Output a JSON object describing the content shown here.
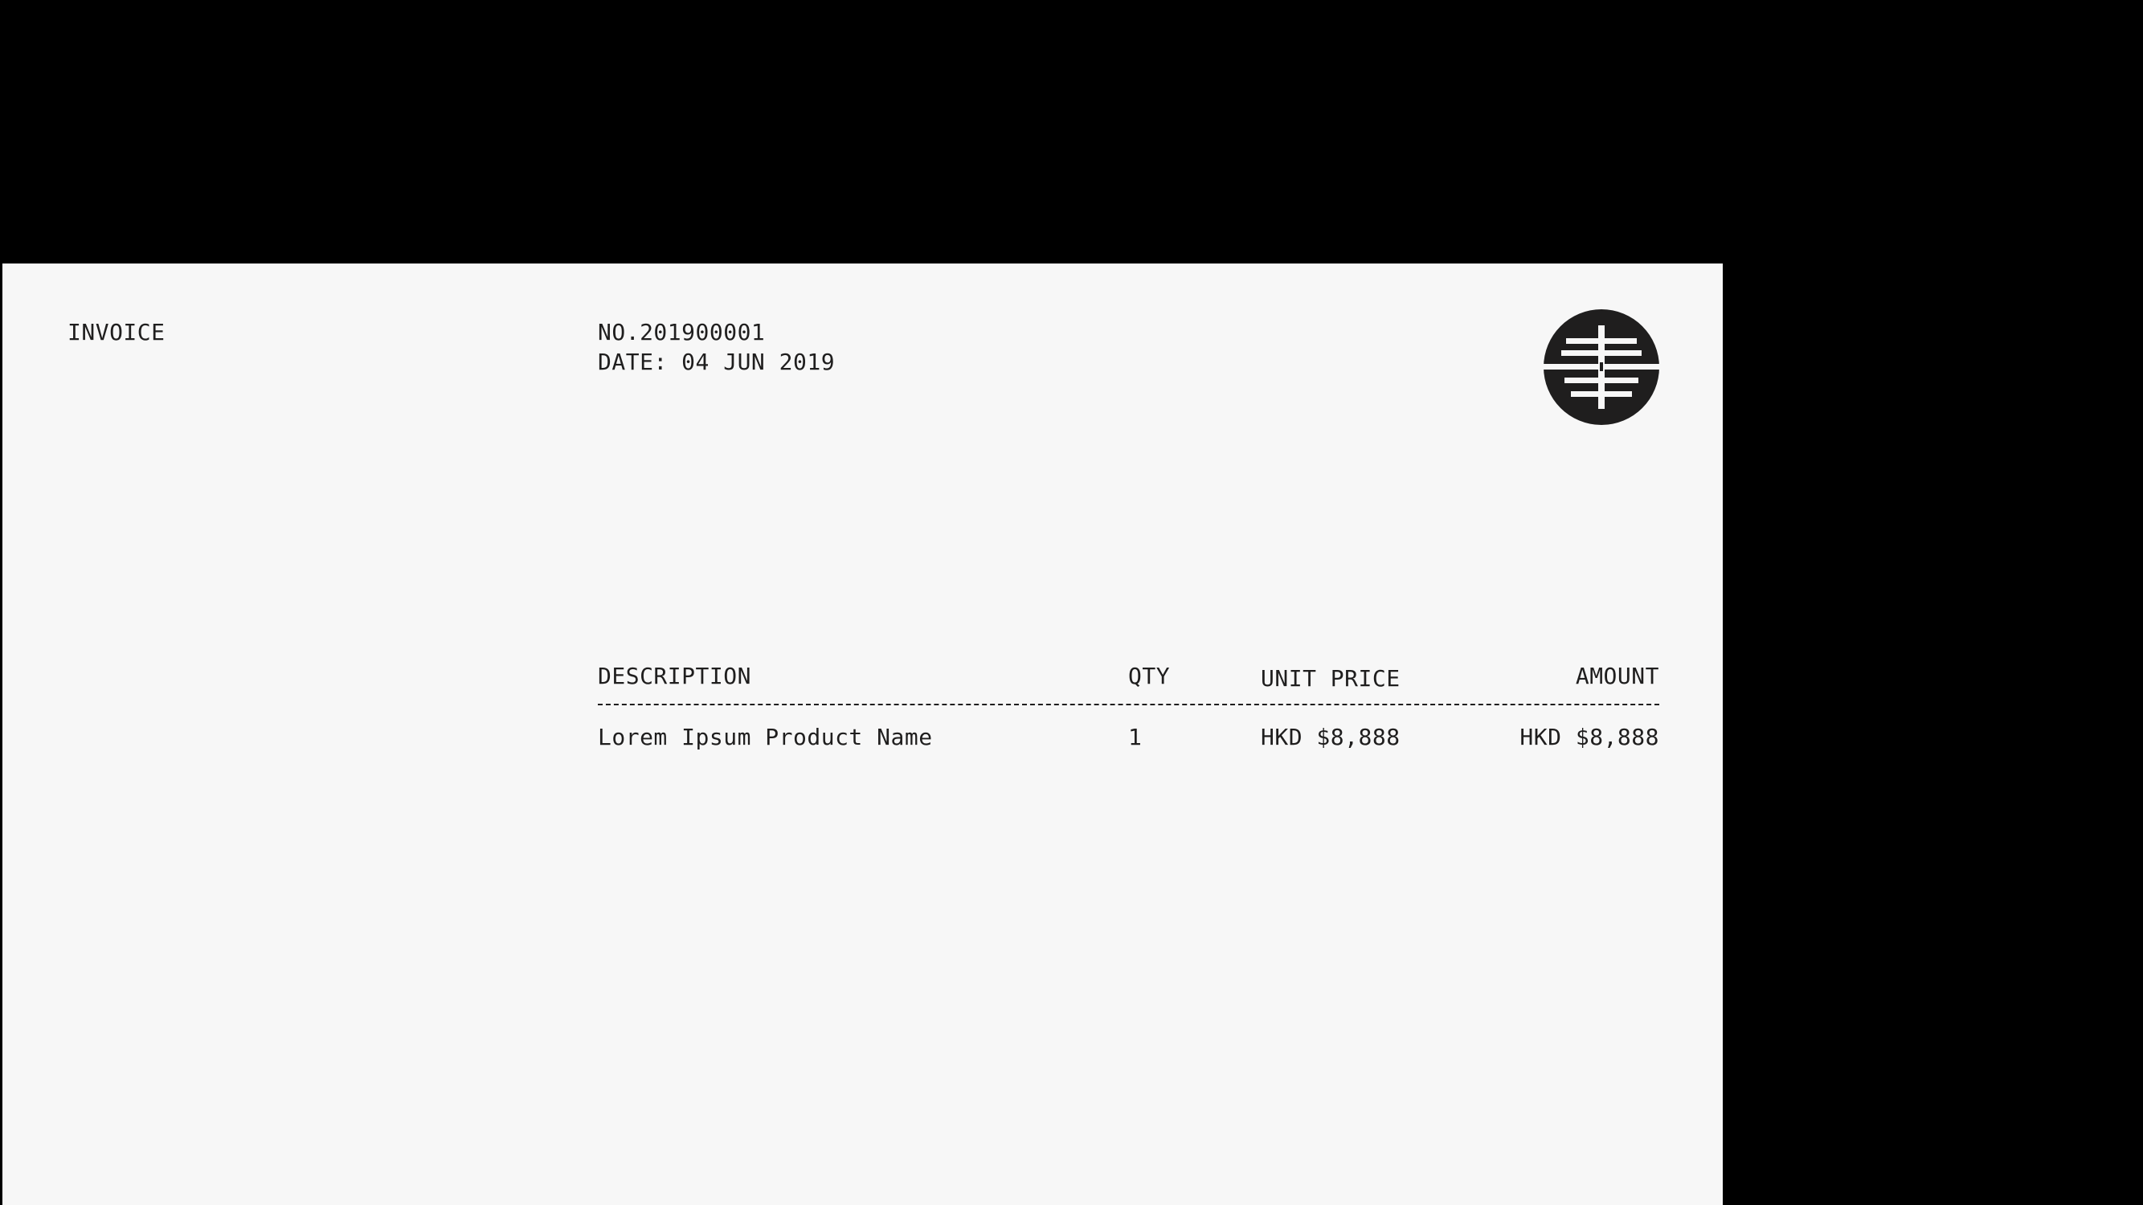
{
  "document": {
    "title": "INVOICE",
    "number": "NO.201900001",
    "date": "DATE: 04 JUN 2019"
  },
  "logo": {
    "icon": "circular-emblem-logo",
    "color": "#1f1e1e"
  },
  "table": {
    "headers": {
      "description": "DESCRIPTION",
      "qty": "QTY",
      "unit_price": "UNIT PRICE",
      "amount": "AMOUNT"
    },
    "rows": [
      {
        "description": "Lorem Ipsum Product Name",
        "qty": "1",
        "unit_price": "HKD $8,888",
        "amount": "HKD $8,888"
      }
    ]
  },
  "colors": {
    "background": "#000000",
    "paper": "#f7f7f7",
    "ink": "#1f1e1e"
  }
}
